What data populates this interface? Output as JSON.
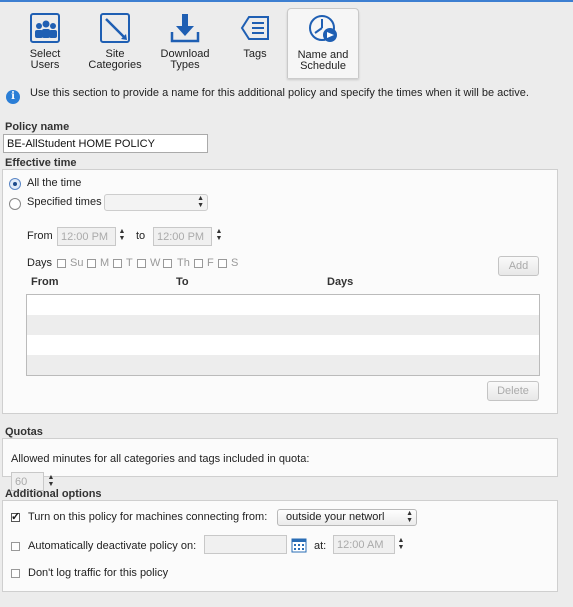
{
  "steps": [
    {
      "label": "Select\nUsers",
      "icon": "users-icon"
    },
    {
      "label": "Site\nCategories",
      "icon": "categories-icon"
    },
    {
      "label": "Download\nTypes",
      "icon": "download-icon"
    },
    {
      "label": "Tags",
      "icon": "tags-icon"
    },
    {
      "label": "Name and\nSchedule",
      "icon": "schedule-icon"
    }
  ],
  "info": {
    "text": "Use this section to provide a name for this additional policy and specify the times when it will be active."
  },
  "policy_name": {
    "label": "Policy name",
    "value": "BE-AllStudent HOME POLICY"
  },
  "effective_time": {
    "label": "Effective time",
    "all_the_time": "All the time",
    "specified_times": "Specified times",
    "specified_select": "",
    "from_label": "From",
    "from_value": "12:00 PM",
    "to_label": "to",
    "to_value": "12:00 PM",
    "days_label": "Days",
    "days": [
      "Su",
      "M",
      "T",
      "W",
      "Th",
      "F",
      "S"
    ],
    "add_label": "Add",
    "columns": [
      "From",
      "To",
      "Days"
    ],
    "delete_label": "Delete"
  },
  "quotas": {
    "label": "Quotas",
    "text": "Allowed minutes for all categories and tags included in quota:",
    "minutes": "60"
  },
  "additional": {
    "label": "Additional options",
    "turn_on_label": "Turn on this policy for machines connecting from:",
    "turn_on_checked": true,
    "network_value": "outside your networl",
    "auto_deactivate_label": "Automatically deactivate policy on:",
    "auto_deactivate_checked": false,
    "date_value": "",
    "at_label": "at:",
    "at_value": "12:00 AM",
    "dont_log_label": "Don't log traffic for this policy",
    "dont_log_checked": false
  },
  "colors": {
    "accent": "#3d7fd1",
    "icon_blue": "#1f5fb3"
  }
}
